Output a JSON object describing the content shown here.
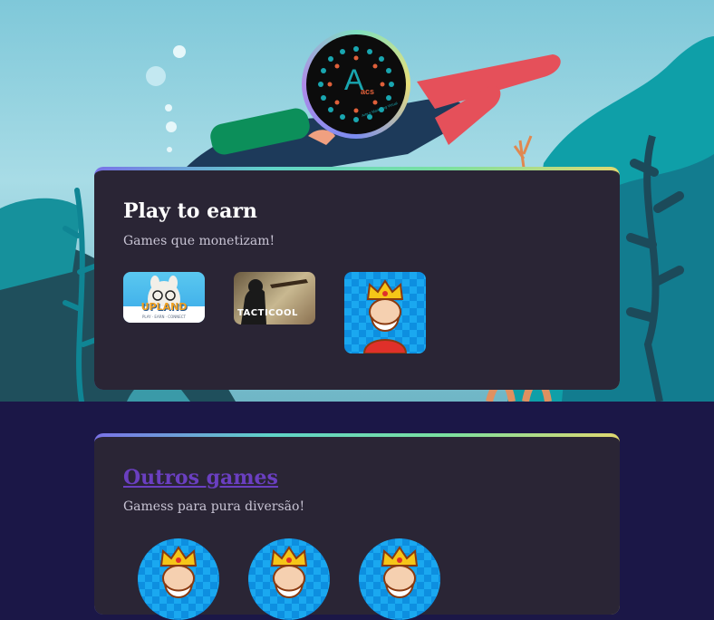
{
  "logo": {
    "letter": "A",
    "small_text": "acs",
    "ring_text": "Arte e Marketing Virtual"
  },
  "play_section": {
    "title": "Play to earn",
    "subtitle": "Games que monetizam!",
    "games": [
      {
        "name": "UPLAND",
        "tagline": "PLAY · EARN · CONNECT",
        "icon": "upland-llama-icon"
      },
      {
        "name": "TACTICOOL",
        "icon": "tacticool-soldier-icon"
      },
      {
        "name": "King",
        "icon": "king-icon"
      }
    ]
  },
  "other_section": {
    "title": "Outros games",
    "subtitle": "Gamess para pura diversão!",
    "games": [
      {
        "name": "King",
        "icon": "king-icon"
      },
      {
        "name": "King",
        "icon": "king-icon"
      },
      {
        "name": "King",
        "icon": "king-icon"
      }
    ]
  },
  "colors": {
    "page_bg": "#1b1747",
    "card_bg": "#2a2535",
    "link_color": "#6a3fc0",
    "accent_gradient": [
      "#7a72e8",
      "#5fd3c8",
      "#7ae0a0",
      "#e0d870"
    ]
  }
}
